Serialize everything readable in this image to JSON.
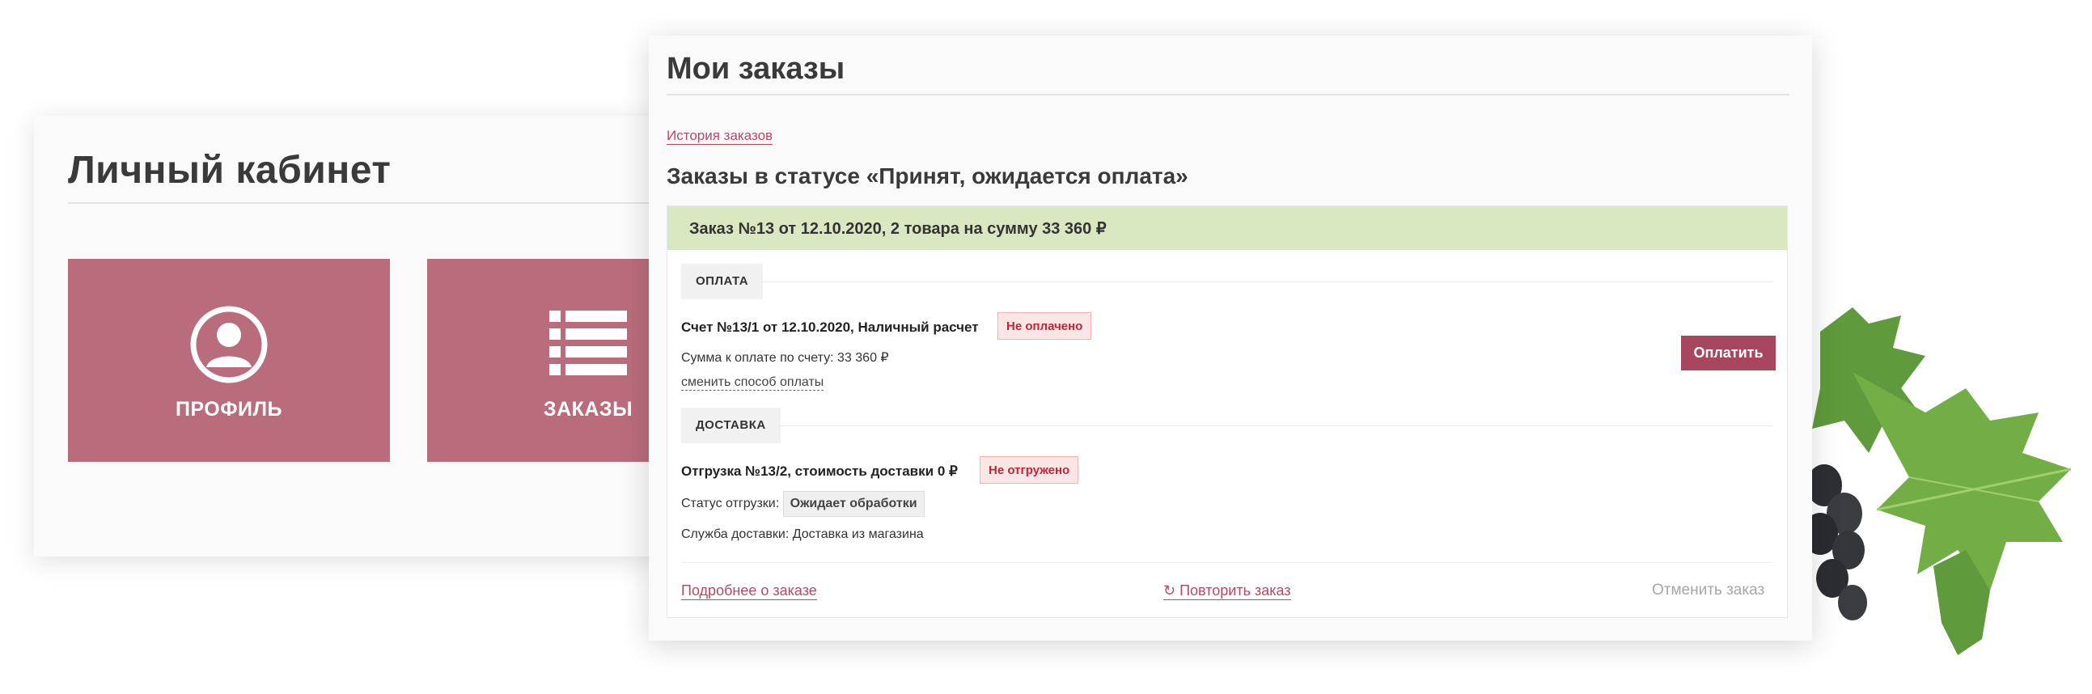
{
  "cabinet": {
    "title": "Личный кабинет",
    "tiles": [
      {
        "label": "ПРОФИЛЬ",
        "icon": "user-profile-icon"
      },
      {
        "label": "ЗАКАЗЫ",
        "icon": "orders-list-icon"
      }
    ]
  },
  "orders": {
    "title": "Мои заказы",
    "history_link": "История заказов",
    "status_heading": "Заказы в статусе «Принят, ожидается оплата»",
    "order": {
      "header": "Заказ №13 от 12.10.2020, 2 товара на сумму 33 360 ₽",
      "payment": {
        "section_label": "ОПЛАТА",
        "invoice": "Счет №13/1 от 12.10.2020, Наличный расчет",
        "status_badge": "Не оплачено",
        "amount_text": "Сумма к оплате по счету: 33 360 ₽",
        "change_method_link": "сменить способ оплаты",
        "pay_button": "Оплатить"
      },
      "delivery": {
        "section_label": "ДОСТАВКА",
        "shipment": "Отгрузка №13/2, стоимость доставки 0 ₽",
        "status_badge": "Не отгружено",
        "shipment_status_label": "Статус отгрузки:",
        "shipment_status_value": "Ожидает обработки",
        "service_text": "Служба доставки: Доставка из магазина"
      },
      "footer": {
        "details_link": "Подробнее о заказе",
        "repeat_link": "Повторить заказ",
        "repeat_icon": "refresh-icon",
        "cancel_link": "Отменить заказ"
      }
    }
  },
  "colors": {
    "tile_bg": "#b96c7c",
    "accent": "#a8455f",
    "link": "#b44a64",
    "order_header_bg": "#d9e8c0",
    "badge_red_text": "#c0243c"
  }
}
